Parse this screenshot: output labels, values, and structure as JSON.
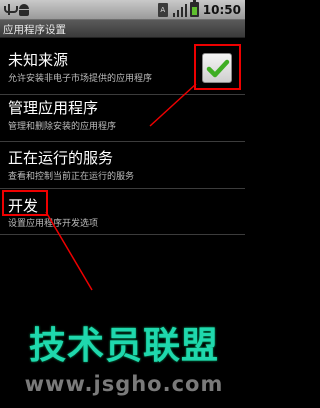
{
  "status_bar": {
    "time": "10:50",
    "sim_label": "A",
    "icons": [
      "usb-icon",
      "android-debug-icon",
      "sim-icon",
      "signal-icon",
      "battery-icon"
    ]
  },
  "title_bar": {
    "title": "应用程序设置"
  },
  "settings": [
    {
      "title": "未知来源",
      "summary": "允许安装非电子市场提供的应用程序",
      "checked": true
    },
    {
      "title": "管理应用程序",
      "summary": "管理和删除安装的应用程序"
    },
    {
      "title": "正在运行的服务",
      "summary": "查看和控制当前正在运行的服务"
    },
    {
      "title": "开发",
      "summary": "设置应用程序开发选项"
    }
  ],
  "watermark": {
    "title": "技术员联盟",
    "url": "www.jsgho.com"
  },
  "colors": {
    "annotation": "#ee0000",
    "check": "#3fae24",
    "watermark": "#1fd8ad"
  }
}
